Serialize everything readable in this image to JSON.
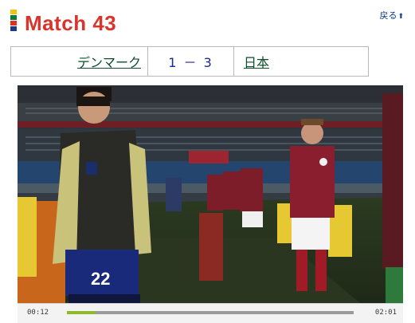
{
  "header": {
    "title": "Match 43",
    "back_label": "戻る",
    "back_arrow": "⬆",
    "flag_colors": [
      "#f4c20d",
      "#0a7a3a",
      "#e0301e",
      "#1a3a8c"
    ]
  },
  "match": {
    "home_team": "デンマーク",
    "score": "1 － 3",
    "away_team": "日本"
  },
  "player": {
    "current_time": "00:12",
    "duration": "02:01",
    "progress": 0.1,
    "progress_color": "#8fba2e",
    "jersey_number": "22"
  }
}
